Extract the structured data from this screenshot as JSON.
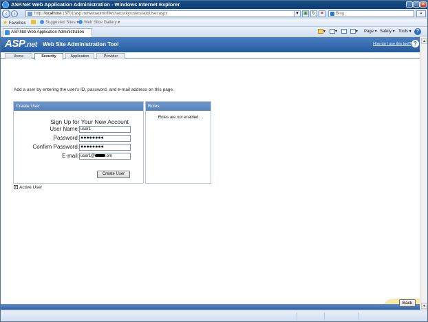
{
  "window": {
    "title": "ASP.Net Web Application Administration - Windows Internet Explorer"
  },
  "address_bar": {
    "url_prefix": "http://",
    "url_host": "localhost",
    "url_rest": ":13701/asp.netwebadminfiles/security/users/addUser.aspx",
    "search_placeholder": "Bing"
  },
  "favorites_bar": {
    "favorites_label": "Favorites",
    "suggested_sites": "Suggested Sites ▾",
    "web_slice_gallery": "Web Slice Gallery ▾"
  },
  "browser_tab": {
    "label": "ASP.Net Web Application Administration"
  },
  "command_bar": {
    "page_label": "Page ▾",
    "safety_label": "Safety ▾",
    "tools_label": "Tools ▾"
  },
  "asp_header": {
    "logo_asp": "ASP",
    "logo_net": ".net",
    "title": "Web Site Administration Tool",
    "help_link": "How do I use this tool?"
  },
  "asp_tabs": [
    {
      "label": "Home"
    },
    {
      "label": "Security"
    },
    {
      "label": "Application"
    },
    {
      "label": "Provider"
    }
  ],
  "main": {
    "intro": "Add a user by entering the user's ID, password, and e-mail address on this page.",
    "create_panel": {
      "header": "Create User",
      "heading": "Sign Up for Your New Account",
      "fields": [
        {
          "label": "User Name:",
          "value": "user1"
        },
        {
          "label": "Password:",
          "value": "●●●●●●●●"
        },
        {
          "label": "Confirm Password:",
          "value": "●●●●●●●●"
        },
        {
          "label": "E-mail:",
          "value_prefix": "user1@",
          "value_suffix": ".om"
        }
      ],
      "submit_label": "Create User"
    },
    "roles_panel": {
      "header": "Roles",
      "message": "Roles are not enabled."
    },
    "active_user": {
      "label": "Active User",
      "checked": true
    },
    "back_label": "Back"
  },
  "colors": {
    "header_blue": "#245b9f",
    "panel_header": "#5583bd",
    "footer_accent": "#f7e9a8"
  }
}
